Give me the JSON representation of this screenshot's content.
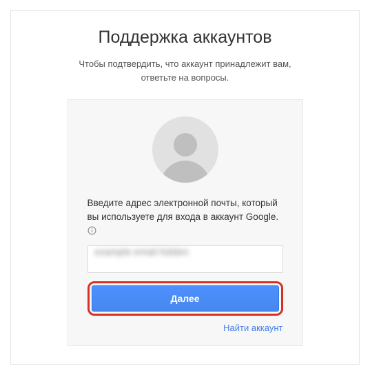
{
  "header": {
    "title": "Поддержка аккаунтов",
    "subtitle": "Чтобы подтвердить, что аккаунт принадлежит вам, ответьте на вопросы."
  },
  "card": {
    "instruction": "Введите адрес электронной почты, который вы используете для входа в аккаунт Google.",
    "info_icon": "info-icon",
    "email_value": "example email hidden",
    "next_label": "Далее",
    "find_account_label": "Найти аккаунт"
  }
}
